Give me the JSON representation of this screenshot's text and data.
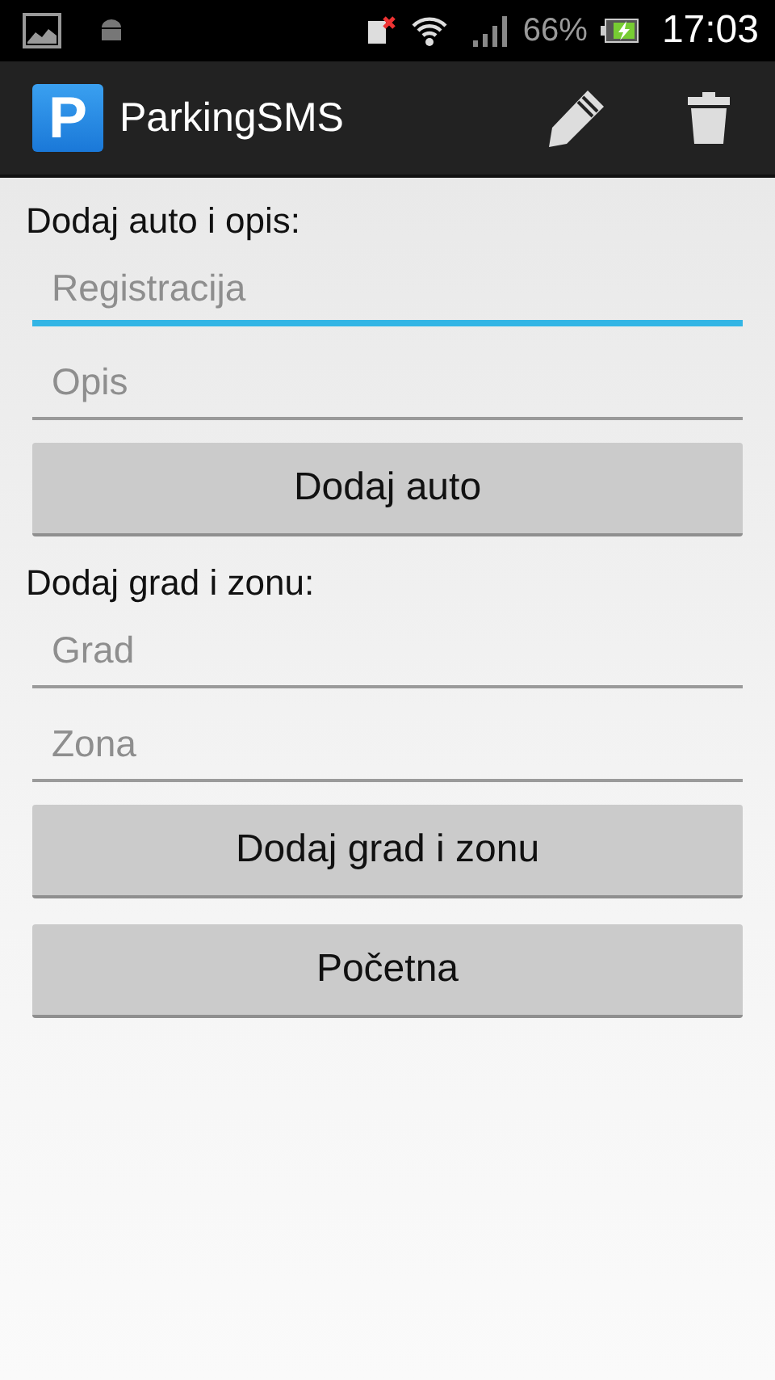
{
  "status_bar": {
    "battery_text": "66%",
    "time": "17:03"
  },
  "action_bar": {
    "logo_letter": "P",
    "title": "ParkingSMS",
    "actions": [
      {
        "kind": "edit"
      },
      {
        "kind": "delete"
      }
    ]
  },
  "sections": [
    {
      "heading": "Dodaj auto i opis:",
      "fields": [
        {
          "placeholder": "Registracija",
          "focused": true
        },
        {
          "placeholder": "Opis",
          "focused": false
        }
      ],
      "button": "Dodaj auto"
    },
    {
      "heading": "Dodaj grad i zonu:",
      "fields": [
        {
          "placeholder": "Grad",
          "focused": false
        },
        {
          "placeholder": "Zona",
          "focused": false
        }
      ],
      "button": "Dodaj grad i zonu"
    }
  ],
  "home_button": "Početna"
}
